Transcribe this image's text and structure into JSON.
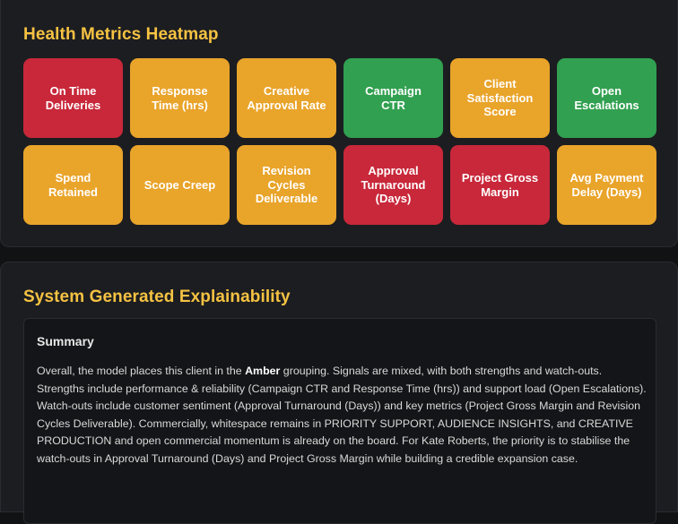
{
  "heatmap": {
    "title": "Health Metrics Heatmap",
    "tiles": [
      {
        "label": "On Time Deliveries",
        "status": "red"
      },
      {
        "label": "Response Time (hrs)",
        "status": "amber"
      },
      {
        "label": "Creative Approval Rate",
        "status": "amber"
      },
      {
        "label": "Campaign CTR",
        "status": "green"
      },
      {
        "label": "Client Satisfaction Score",
        "status": "amber"
      },
      {
        "label": "Open Escalations",
        "status": "green"
      },
      {
        "label": "Spend Retained",
        "status": "amber"
      },
      {
        "label": "Scope Creep",
        "status": "amber"
      },
      {
        "label": "Revision Cycles Deliverable",
        "status": "amber"
      },
      {
        "label": "Approval Turnaround (Days)",
        "status": "red"
      },
      {
        "label": "Project Gross Margin",
        "status": "red"
      },
      {
        "label": "Avg Payment Delay (Days)",
        "status": "amber"
      }
    ],
    "colors": {
      "red": "#c8283a",
      "amber": "#e9a42a",
      "green": "#31a050"
    }
  },
  "explainability": {
    "title": "System Generated Explainability",
    "summary_heading": "Summary",
    "summary_prefix": "Overall, the model places this client in the ",
    "summary_grouping": "Amber",
    "summary_rest": " grouping. Signals are mixed, with both strengths and watch-outs. Strengths include performance & reliability (Campaign CTR and Response Time (hrs)) and support load (Open Escalations). Watch-outs include customer sentiment (Approval Turnaround (Days)) and key metrics (Project Gross Margin and Revision Cycles Deliverable). Commercially, whitespace remains in PRIORITY SUPPORT, AUDIENCE INSIGHTS, and CREATIVE PRODUCTION and open commercial momentum is already on the board. For Kate Roberts, the priority is to stabilise the watch-outs in Approval Turnaround (Days) and Project Gross Margin while building a credible expansion case."
  }
}
